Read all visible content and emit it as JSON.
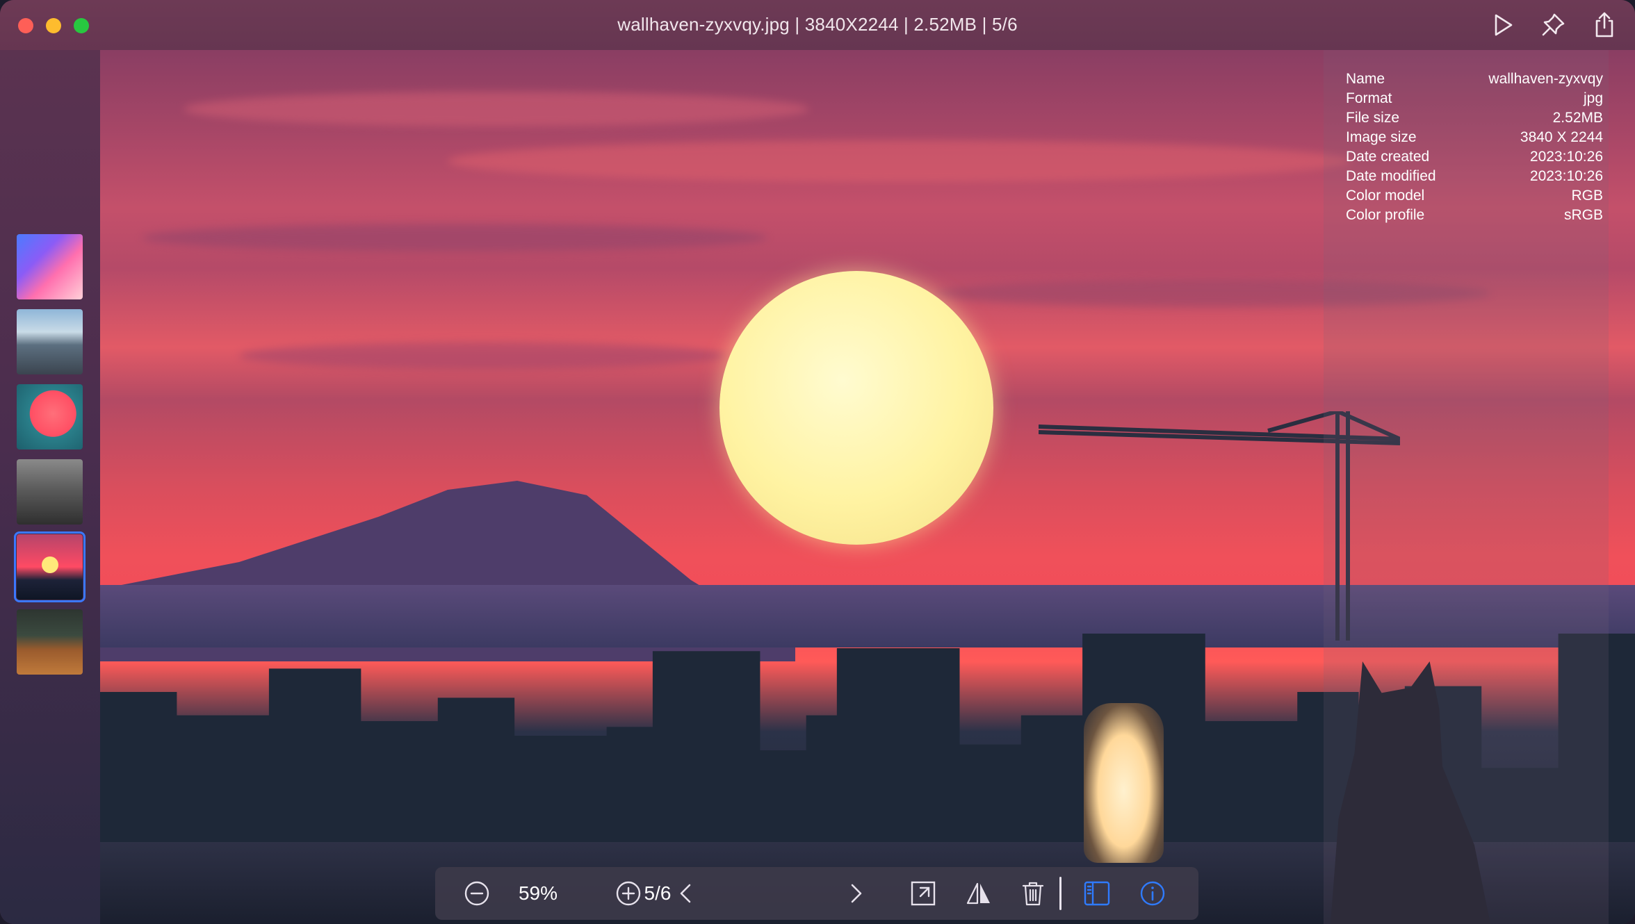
{
  "window": {
    "title": "wallhaven-zyxvqy.jpg | 3840X2244 | 2.52MB | 5/6"
  },
  "titlebar_actions": [
    {
      "name": "play-icon"
    },
    {
      "name": "pin-icon"
    },
    {
      "name": "share-icon"
    }
  ],
  "sidebar": {
    "thumbnails": [
      {
        "name": "thumbnail-gradient"
      },
      {
        "name": "thumbnail-mountain-road"
      },
      {
        "name": "thumbnail-pink-sunset"
      },
      {
        "name": "thumbnail-trees-bw"
      },
      {
        "name": "thumbnail-city-sunset",
        "selected": true
      },
      {
        "name": "thumbnail-interior"
      }
    ]
  },
  "info_panel": {
    "rows": [
      {
        "key": "Name",
        "value": "wallhaven-zyxvqy"
      },
      {
        "key": "Format",
        "value": "jpg"
      },
      {
        "key": "File size",
        "value": "2.52MB"
      },
      {
        "key": "Image size",
        "value": "3840 X 2244"
      },
      {
        "key": "Date created",
        "value": "2023:10:26"
      },
      {
        "key": "Date modified",
        "value": "2023:10:26"
      },
      {
        "key": "Color model",
        "value": "RGB"
      },
      {
        "key": "Color profile",
        "value": "sRGB"
      }
    ]
  },
  "toolbar": {
    "zoom": "59%",
    "page": "5/6",
    "icons": [
      "zoom-out-icon",
      "zoom-in-icon",
      "chevron-left-icon",
      "chevron-right-icon",
      "fit-window-icon",
      "flip-icon",
      "trash-icon",
      "sidebar-toggle-icon",
      "info-icon"
    ]
  },
  "colors": {
    "accent": "#3b78ff",
    "titlebar": "#6d3a55"
  }
}
